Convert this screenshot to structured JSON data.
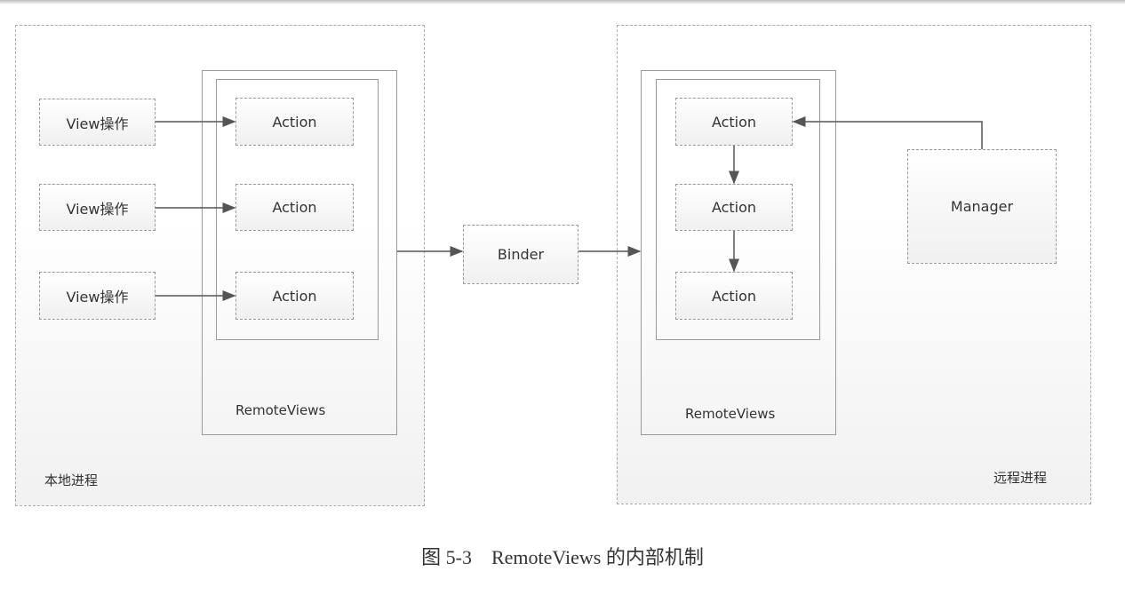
{
  "local_process": {
    "label": "本地进程",
    "view_ops": [
      "View操作",
      "View操作",
      "View操作"
    ],
    "remoteviews": {
      "label": "RemoteViews",
      "actions": [
        "Action",
        "Action",
        "Action"
      ]
    }
  },
  "binder": {
    "label": "Binder"
  },
  "remote_process": {
    "label": "远程进程",
    "remoteviews": {
      "label": "RemoteViews",
      "actions": [
        "Action",
        "Action",
        "Action"
      ]
    },
    "manager": {
      "label": "Manager"
    }
  },
  "caption": "图 5-3　RemoteViews 的内部机制"
}
